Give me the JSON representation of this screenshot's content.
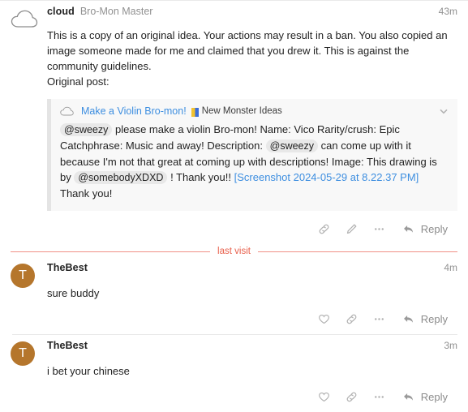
{
  "theme": {
    "accent_link": "#3d8ee0",
    "avatar_color": "#b5762c",
    "lastvisit_color": "#e8604c",
    "quote_bg": "#f8f8f8",
    "muted_text": "#919191"
  },
  "divider": {
    "last_visit_label": "last visit"
  },
  "posts": [
    {
      "username": "cloud",
      "user_title": "Bro-Mon Master",
      "avatar_type": "cloud-avatar",
      "avatar_letter": "",
      "time": "43m",
      "text_line_1": "This is a copy of an original idea. Your actions may result in a ban. You also copied an image someone",
      "text_line_2": "made for me and claimed that you drew it. This is against the community guidelines.",
      "text_line_3": "Original post:",
      "quote": {
        "title": "Make a Violin Bro-mon!",
        "category": "New Monster Ideas",
        "mention_1": "@sweezy",
        "segment_1": "please make a violin Bro-mon! Name: Vico Rarity/crush: Epic Catchphrase: Music and away! Description:",
        "mention_2": "@sweezy",
        "segment_2": "can come up with it because I'm not that great at coming up with descriptions! Image: This drawing is by",
        "mention_3": "@somebodyXDXD",
        "segment_3": "! Thank you!!",
        "link_text": "[Screenshot 2024-05-29 at 8.22.37 PM]",
        "segment_4": "Thank you!"
      },
      "actions": {
        "has_like": false,
        "like_label": "like",
        "link_label": "share link",
        "edit_label": "edit",
        "more_label": "more options",
        "reply_label": "Reply"
      }
    },
    {
      "username": "TheBest",
      "user_title": "",
      "avatar_type": "letter-avatar",
      "avatar_letter": "T",
      "time": "4m",
      "text_line_1": "sure buddy",
      "text_line_2": "",
      "text_line_3": "",
      "quote": null,
      "actions": {
        "has_like": true,
        "like_label": "like",
        "link_label": "share link",
        "edit_label": "edit",
        "more_label": "more options",
        "reply_label": "Reply"
      }
    },
    {
      "username": "TheBest",
      "user_title": "",
      "avatar_type": "letter-avatar",
      "avatar_letter": "T",
      "time": "3m",
      "text_line_1": "i bet your chinese",
      "text_line_2": "",
      "text_line_3": "",
      "quote": null,
      "actions": {
        "has_like": true,
        "like_label": "like",
        "link_label": "share link",
        "edit_label": "edit",
        "more_label": "more options",
        "reply_label": "Reply"
      }
    }
  ]
}
